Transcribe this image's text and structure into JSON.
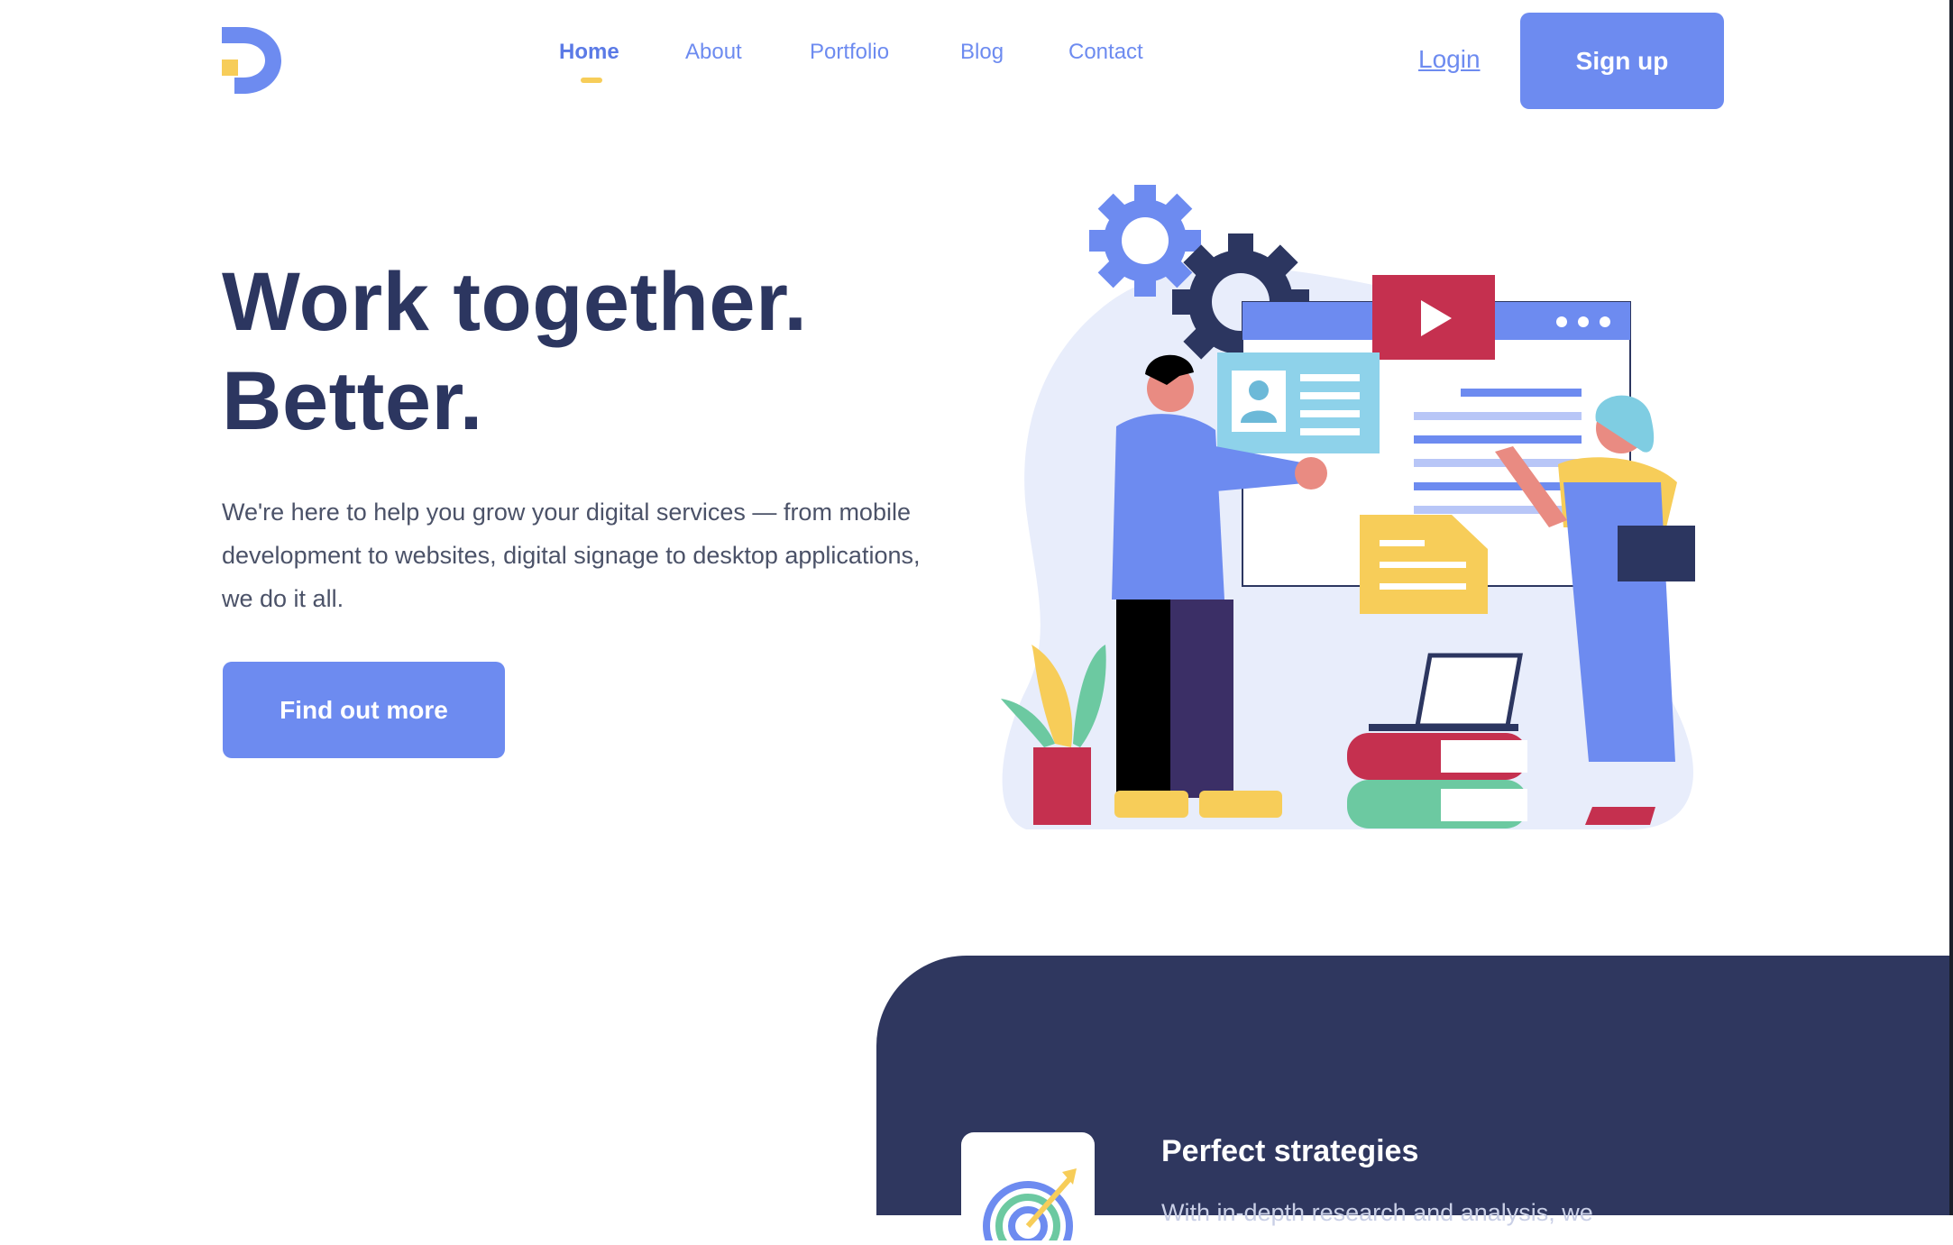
{
  "nav": {
    "items": [
      {
        "label": "Home",
        "active": true
      },
      {
        "label": "About"
      },
      {
        "label": "Portfolio"
      },
      {
        "label": "Blog"
      },
      {
        "label": "Contact"
      }
    ],
    "login": "Login",
    "signup": "Sign up"
  },
  "hero": {
    "title_line1": "Work together.",
    "title_line2": "Better.",
    "description": "We're here to help you grow your digital services — from mobile development to websites, digital signage to desktop applications, we do it all.",
    "cta": "Find out more"
  },
  "feature": {
    "title": "Perfect strategies",
    "text": "With in-depth research and analysis, we"
  },
  "colors": {
    "primary": "#6d8bf0",
    "navy": "#2f375f",
    "accent_yellow": "#f7cd59",
    "accent_red": "#c5304f",
    "accent_green": "#6cc9a1"
  }
}
